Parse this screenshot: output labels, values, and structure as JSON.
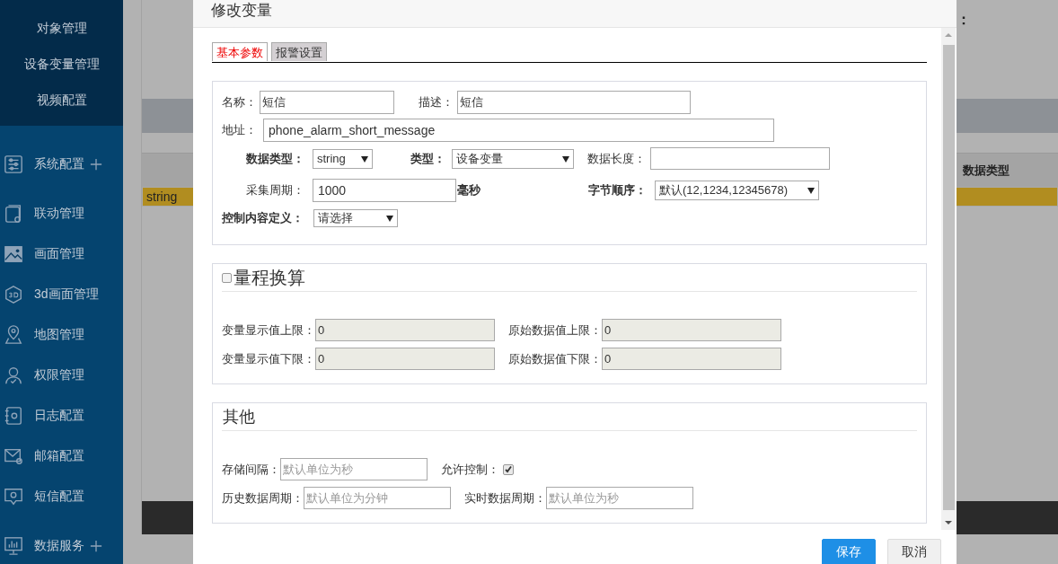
{
  "background": {
    "heading_fragment": "：",
    "table": {
      "columns": [
        "数据类型"
      ],
      "rows": [
        {
          "cells": [
            "string"
          ],
          "selected": true
        }
      ]
    }
  },
  "sidebar": {
    "submenu": [
      {
        "label": "对象管理"
      },
      {
        "label": "设备变量管理"
      },
      {
        "label": "视频配置"
      }
    ],
    "items": [
      {
        "label": "系统配置",
        "kind": "sliders",
        "expandable": true
      },
      {
        "label": "联动管理",
        "kind": "linkcard",
        "expandable": false
      },
      {
        "label": "画面管理",
        "kind": "image",
        "expandable": false
      },
      {
        "label": "3d画面管理",
        "kind": "cube3d",
        "expandable": false
      },
      {
        "label": "地图管理",
        "kind": "pin",
        "expandable": false
      },
      {
        "label": "权限管理",
        "kind": "user",
        "expandable": false
      },
      {
        "label": "日志配置",
        "kind": "log",
        "expandable": false
      },
      {
        "label": "邮箱配置",
        "kind": "mail",
        "expandable": false
      },
      {
        "label": "短信配置",
        "kind": "message",
        "expandable": false
      },
      {
        "label": "数据服务",
        "kind": "chart",
        "expandable": true
      }
    ]
  },
  "dialog": {
    "title": "修改变量",
    "tabs": [
      {
        "label": "基本参数",
        "selected": true
      },
      {
        "label": "报警设置",
        "selected": false
      }
    ],
    "basic": {
      "name": {
        "label": "名称：",
        "value": "短信"
      },
      "description": {
        "label": "描述：",
        "value": "短信"
      },
      "address": {
        "label": "地址：",
        "value": "phone_alarm_short_message"
      },
      "data_type": {
        "label": "数据类型：",
        "value": "string"
      },
      "type": {
        "label": "类型：",
        "value": "设备变量"
      },
      "data_length": {
        "label": "数据长度："
      },
      "period": {
        "label": "采集周期：",
        "value": "1000",
        "unit": "毫秒"
      },
      "byte_order": {
        "label": "字节顺序：",
        "value": "默认(12,1234,12345678)"
      },
      "control_definition": {
        "label": "控制内容定义：",
        "value": "请选择"
      }
    },
    "range": {
      "title": "量程换算",
      "checked": false,
      "rows": [
        [
          {
            "label": "变量显示值上限：",
            "value": "0",
            "disabled": true
          },
          {
            "label": "原始数据值上限：",
            "value": "0",
            "disabled": true
          }
        ],
        [
          {
            "label": "变量显示值下限：",
            "value": "0",
            "disabled": true
          },
          {
            "label": "原始数据值下限：",
            "value": "0",
            "disabled": true
          }
        ]
      ]
    },
    "other": {
      "title": "其他",
      "rows": [
        [
          {
            "kind": "input",
            "label": "存储间隔：",
            "placeholder": "默认单位为秒"
          },
          {
            "kind": "checkbox",
            "label": "允许控制：",
            "checked": true
          }
        ],
        [
          {
            "kind": "input",
            "label": "历史数据周期：",
            "placeholder": "默认单位为分钟"
          },
          {
            "kind": "input",
            "label": "实时数据周期：",
            "placeholder": "默认单位为秒"
          }
        ]
      ]
    },
    "buttons": [
      {
        "label": "保存",
        "kind": "primary"
      },
      {
        "label": "取消",
        "kind": "default"
      }
    ]
  }
}
